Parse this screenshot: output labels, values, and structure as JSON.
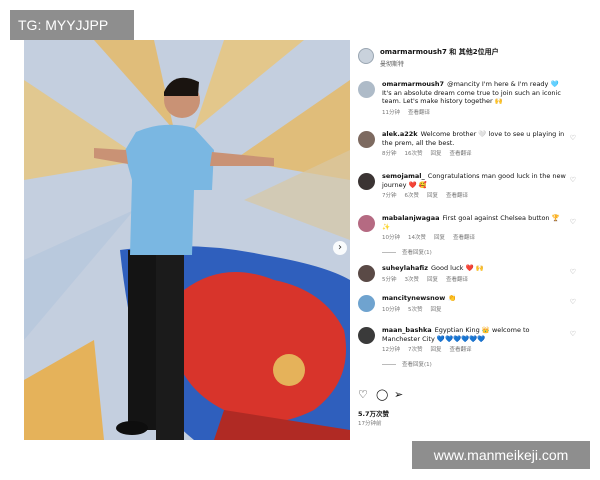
{
  "watermarks": {
    "tg": "TG: MYYJJPP",
    "site": "www.manmeikeji.com"
  },
  "post": {
    "header": {
      "accounts": "omarmarmoush7 和 其他2位用户",
      "location": "曼彻斯特"
    },
    "caption": {
      "user": "omarmarmoush7",
      "text": "@mancity I'm here & I'm ready 🩵 It's an absolute dream come true to join such an iconic team. Let's make history together 🙌",
      "meta": [
        "11分钟",
        "查看翻译"
      ]
    },
    "comments": [
      {
        "user": "alek.a22k",
        "text": "Welcome brother 🤍 love to see u playing in the prem, all the best.",
        "meta": [
          "8分钟",
          "16次赞",
          "回复",
          "查看翻译"
        ]
      },
      {
        "user": "semojamal_",
        "text": "Congratulations man good luck in the new journey ❤️ 🥰",
        "meta": [
          "7分钟",
          "6次赞",
          "回复",
          "查看翻译"
        ]
      },
      {
        "user": "mabalanjwagaa",
        "text": "First goal against Chelsea button 🏆 ✨",
        "meta": [
          "10分钟",
          "14次赞",
          "回复",
          "查看翻译"
        ],
        "replies": "查看回复(1)"
      },
      {
        "user": "suheylahafiz",
        "text": "Good luck ❤️ 🙌",
        "meta": [
          "5分钟",
          "3次赞",
          "回复",
          "查看翻译"
        ]
      },
      {
        "user": "mancitynewsnow",
        "text": "👏",
        "meta": [
          "10分钟",
          "5次赞",
          "回复"
        ]
      },
      {
        "user": "maan_bashka",
        "text": "Egyptian King 👑 welcome to Manchester City 💙💙💙💙💙💙",
        "meta": [
          "12分钟",
          "7次赞",
          "回复",
          "查看翻译"
        ],
        "replies": "查看回复(1)"
      }
    ],
    "likes": "5.7万次赞",
    "time": "17分钟前"
  },
  "icons": [
    "heart-icon",
    "comment-icon",
    "share-icon",
    "chevron-right-icon"
  ],
  "colors": {
    "jersey": "#7ab7e2",
    "flag_red": "#d8342b",
    "flag_blue": "#2f5fbd",
    "gold": "#e5b25a"
  }
}
